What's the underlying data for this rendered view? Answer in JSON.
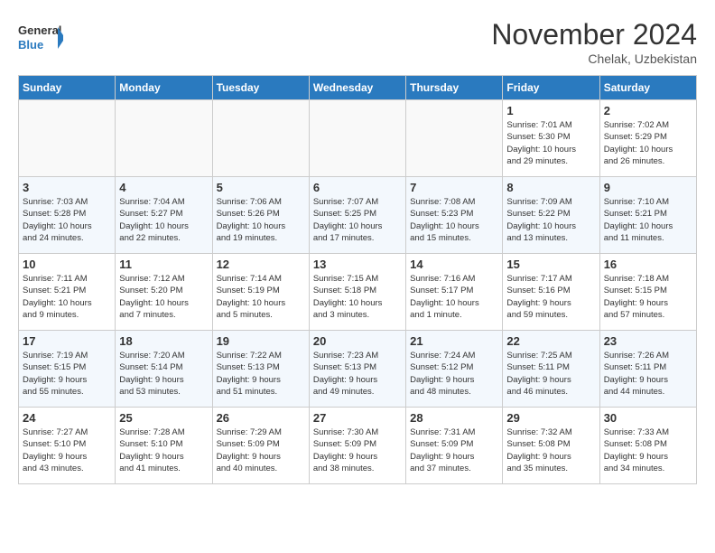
{
  "logo": {
    "line1": "General",
    "line2": "Blue"
  },
  "title": "November 2024",
  "location": "Chelak, Uzbekistan",
  "weekdays": [
    "Sunday",
    "Monday",
    "Tuesday",
    "Wednesday",
    "Thursday",
    "Friday",
    "Saturday"
  ],
  "weeks": [
    [
      {
        "day": "",
        "info": ""
      },
      {
        "day": "",
        "info": ""
      },
      {
        "day": "",
        "info": ""
      },
      {
        "day": "",
        "info": ""
      },
      {
        "day": "",
        "info": ""
      },
      {
        "day": "1",
        "info": "Sunrise: 7:01 AM\nSunset: 5:30 PM\nDaylight: 10 hours\nand 29 minutes."
      },
      {
        "day": "2",
        "info": "Sunrise: 7:02 AM\nSunset: 5:29 PM\nDaylight: 10 hours\nand 26 minutes."
      }
    ],
    [
      {
        "day": "3",
        "info": "Sunrise: 7:03 AM\nSunset: 5:28 PM\nDaylight: 10 hours\nand 24 minutes."
      },
      {
        "day": "4",
        "info": "Sunrise: 7:04 AM\nSunset: 5:27 PM\nDaylight: 10 hours\nand 22 minutes."
      },
      {
        "day": "5",
        "info": "Sunrise: 7:06 AM\nSunset: 5:26 PM\nDaylight: 10 hours\nand 19 minutes."
      },
      {
        "day": "6",
        "info": "Sunrise: 7:07 AM\nSunset: 5:25 PM\nDaylight: 10 hours\nand 17 minutes."
      },
      {
        "day": "7",
        "info": "Sunrise: 7:08 AM\nSunset: 5:23 PM\nDaylight: 10 hours\nand 15 minutes."
      },
      {
        "day": "8",
        "info": "Sunrise: 7:09 AM\nSunset: 5:22 PM\nDaylight: 10 hours\nand 13 minutes."
      },
      {
        "day": "9",
        "info": "Sunrise: 7:10 AM\nSunset: 5:21 PM\nDaylight: 10 hours\nand 11 minutes."
      }
    ],
    [
      {
        "day": "10",
        "info": "Sunrise: 7:11 AM\nSunset: 5:21 PM\nDaylight: 10 hours\nand 9 minutes."
      },
      {
        "day": "11",
        "info": "Sunrise: 7:12 AM\nSunset: 5:20 PM\nDaylight: 10 hours\nand 7 minutes."
      },
      {
        "day": "12",
        "info": "Sunrise: 7:14 AM\nSunset: 5:19 PM\nDaylight: 10 hours\nand 5 minutes."
      },
      {
        "day": "13",
        "info": "Sunrise: 7:15 AM\nSunset: 5:18 PM\nDaylight: 10 hours\nand 3 minutes."
      },
      {
        "day": "14",
        "info": "Sunrise: 7:16 AM\nSunset: 5:17 PM\nDaylight: 10 hours\nand 1 minute."
      },
      {
        "day": "15",
        "info": "Sunrise: 7:17 AM\nSunset: 5:16 PM\nDaylight: 9 hours\nand 59 minutes."
      },
      {
        "day": "16",
        "info": "Sunrise: 7:18 AM\nSunset: 5:15 PM\nDaylight: 9 hours\nand 57 minutes."
      }
    ],
    [
      {
        "day": "17",
        "info": "Sunrise: 7:19 AM\nSunset: 5:15 PM\nDaylight: 9 hours\nand 55 minutes."
      },
      {
        "day": "18",
        "info": "Sunrise: 7:20 AM\nSunset: 5:14 PM\nDaylight: 9 hours\nand 53 minutes."
      },
      {
        "day": "19",
        "info": "Sunrise: 7:22 AM\nSunset: 5:13 PM\nDaylight: 9 hours\nand 51 minutes."
      },
      {
        "day": "20",
        "info": "Sunrise: 7:23 AM\nSunset: 5:13 PM\nDaylight: 9 hours\nand 49 minutes."
      },
      {
        "day": "21",
        "info": "Sunrise: 7:24 AM\nSunset: 5:12 PM\nDaylight: 9 hours\nand 48 minutes."
      },
      {
        "day": "22",
        "info": "Sunrise: 7:25 AM\nSunset: 5:11 PM\nDaylight: 9 hours\nand 46 minutes."
      },
      {
        "day": "23",
        "info": "Sunrise: 7:26 AM\nSunset: 5:11 PM\nDaylight: 9 hours\nand 44 minutes."
      }
    ],
    [
      {
        "day": "24",
        "info": "Sunrise: 7:27 AM\nSunset: 5:10 PM\nDaylight: 9 hours\nand 43 minutes."
      },
      {
        "day": "25",
        "info": "Sunrise: 7:28 AM\nSunset: 5:10 PM\nDaylight: 9 hours\nand 41 minutes."
      },
      {
        "day": "26",
        "info": "Sunrise: 7:29 AM\nSunset: 5:09 PM\nDaylight: 9 hours\nand 40 minutes."
      },
      {
        "day": "27",
        "info": "Sunrise: 7:30 AM\nSunset: 5:09 PM\nDaylight: 9 hours\nand 38 minutes."
      },
      {
        "day": "28",
        "info": "Sunrise: 7:31 AM\nSunset: 5:09 PM\nDaylight: 9 hours\nand 37 minutes."
      },
      {
        "day": "29",
        "info": "Sunrise: 7:32 AM\nSunset: 5:08 PM\nDaylight: 9 hours\nand 35 minutes."
      },
      {
        "day": "30",
        "info": "Sunrise: 7:33 AM\nSunset: 5:08 PM\nDaylight: 9 hours\nand 34 minutes."
      }
    ]
  ]
}
